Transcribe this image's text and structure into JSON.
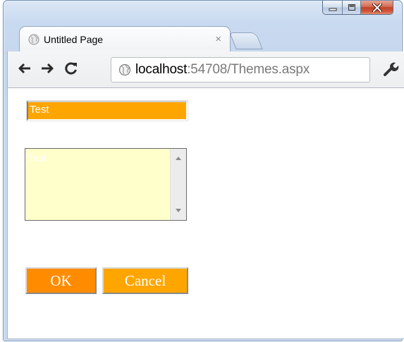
{
  "browser": {
    "tab": {
      "title": "Untitled Page",
      "close_glyph": "×"
    },
    "address_bar": {
      "host": "localhost",
      "rest": ":54708/Themes.aspx"
    },
    "icons": {
      "minimize": "minimize-icon",
      "maximize": "maximize-icon",
      "close": "close-icon",
      "back": "back-arrow-icon",
      "forward": "forward-arrow-icon",
      "reload": "reload-icon",
      "favicon": "globe-icon",
      "wrench": "wrench-icon"
    }
  },
  "page": {
    "textbox": {
      "value": "Test"
    },
    "textarea": {
      "value": "Test"
    },
    "ok_button": {
      "label": "OK"
    },
    "cancel_button": {
      "label": "Cancel"
    }
  },
  "colors": {
    "textbox_bg": "#ffa500",
    "textarea_bg": "#ffffcc",
    "ok_bg": "#ff8c00",
    "cancel_bg": "#ffa500",
    "window_close_red": "#c0422a"
  }
}
